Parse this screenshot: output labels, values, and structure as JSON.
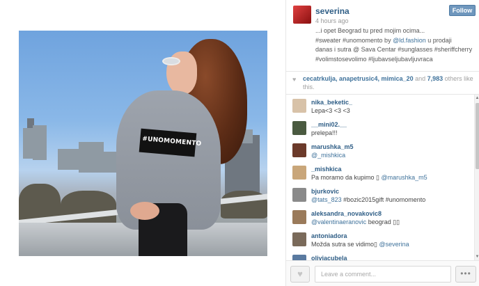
{
  "post": {
    "username": "severina",
    "time_ago": "4 hours ago",
    "follow_label": "Follow",
    "caption": {
      "line1": "...i opet Beograd tu pred mojim ocima...",
      "line2_before": "#sweater #unomomento by ",
      "line2_mention": "@ld.fashion",
      "line2_after": " u prodaji",
      "line3": "danas i sutra @ Sava Centar #sunglasses #sheriffcherry",
      "line4": "#volimstosevolimo #ljubavseljubavljuvraca"
    },
    "photo_sweater_text": "#UNOMOMENTO"
  },
  "likes": {
    "names": "cecatrkulja, anapetrusic4, mimica_20",
    "middle": " and ",
    "count": "7,983",
    "suffix": " others like this."
  },
  "comments": [
    {
      "user": "nika_beketic_",
      "text": "Lepa<3 <3 <3",
      "mention": "",
      "avatar_color": "#d8c2a8"
    },
    {
      "user": "__mini02.__",
      "text": "prelepa!!!",
      "mention": "",
      "avatar_color": "#4a5a40"
    },
    {
      "user": "marushka_m5",
      "text": "",
      "mention": "@_mishkica",
      "avatar_color": "#6b3a2a"
    },
    {
      "user": "_mishkica",
      "text": "Pa moramo da kupimo ▯ ",
      "mention": "@marushka_m5",
      "avatar_color": "#c9a67a"
    },
    {
      "user": "bjurkovic",
      "text": " #bozic2015gift #unomomento",
      "mention": "@tats_823",
      "mention_first": true,
      "avatar_color": "#8a8a8a"
    },
    {
      "user": "aleksandra_novakovic8",
      "text": " beograd ▯▯",
      "mention": "@valentinaeranovic",
      "mention_first": true,
      "avatar_color": "#9a7a5a"
    },
    {
      "user": "antoniadora",
      "text": "Možda sutra se vidimo▯ ",
      "mention": "@severina",
      "avatar_color": "#7a6a5a"
    },
    {
      "user": "oliviacubela",
      "text": "",
      "mention": "",
      "avatar_color": "#5a7aa0"
    }
  ],
  "comment_input": {
    "placeholder": "Leave a comment..."
  },
  "icons": {
    "heart": "heart-icon",
    "more": "more-options-icon"
  },
  "colors": {
    "username": "#2f5e86",
    "mention": "#3f729b",
    "follow_button": "#6f97bd"
  }
}
